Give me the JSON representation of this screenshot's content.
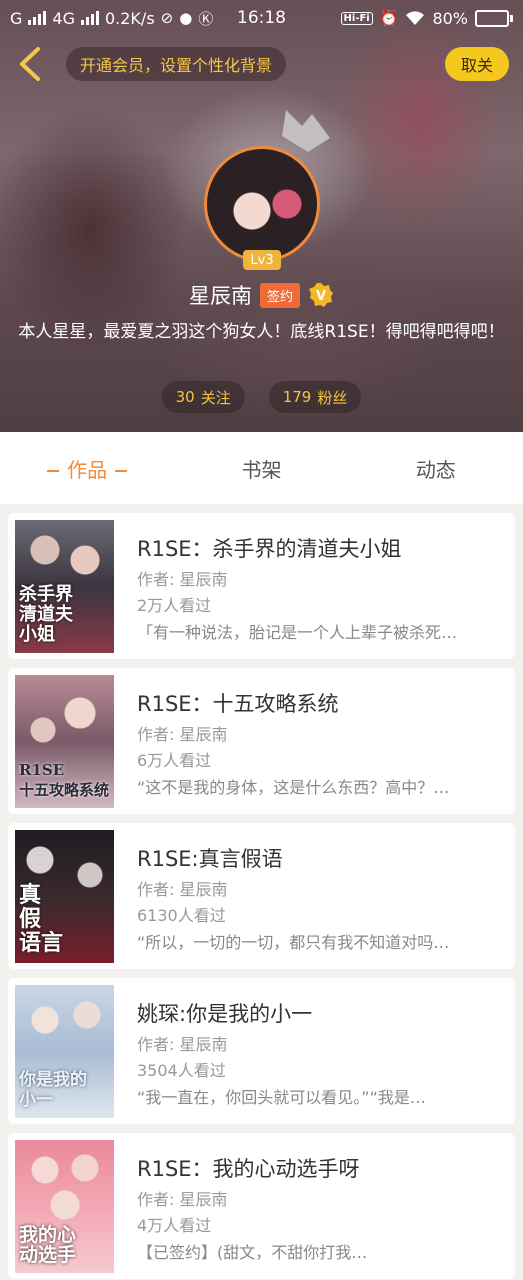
{
  "status_bar": {
    "carrier1": "G",
    "carrier2": "4G",
    "speed": "0.2K/s",
    "time": "16:18",
    "hifi": "Hi-Fi",
    "battery_text": "80%",
    "battery_level": 0.8
  },
  "header": {
    "vip_banner": "开通会员，设置个性化背景",
    "follow_button": "取关",
    "level_badge": "Lv3",
    "user_name": "星辰南",
    "sign_badge": "签约",
    "bio": "本人星星，最爱夏之羽这个狗女人！底线R1SE！得吧得吧得吧！",
    "following_count": "30",
    "following_label": "关注",
    "fans_count": "179",
    "fans_label": "粉丝"
  },
  "tabs": [
    {
      "label": "作品",
      "active": true
    },
    {
      "label": "书架",
      "active": false
    },
    {
      "label": "动态",
      "active": false
    }
  ],
  "books": [
    {
      "title": "R1SE：杀手界的清道夫小姐",
      "author": "作者: 星辰南",
      "views": "2万人看过",
      "excerpt": "「有一种说法，胎记是一个人上辈子被杀死…",
      "cover_text": "杀手界\n清道夫\n小姐"
    },
    {
      "title": "R1SE：十五攻略系统",
      "author": "作者: 星辰南",
      "views": "6万人看过",
      "excerpt": "“这不是我的身体，这是什么东西？高中？…",
      "cover_text": "R1SE\n十五攻略系统"
    },
    {
      "title": "R1SE:真言假语",
      "author": "作者: 星辰南",
      "views": "6130人看过",
      "excerpt": "“所以，一切的一切，都只有我不知道对吗…",
      "cover_text": "真\n假\n语言"
    },
    {
      "title": "姚琛:你是我的小一",
      "author": "作者: 星辰南",
      "views": "3504人看过",
      "excerpt": "“我一直在，你回头就可以看见。”“我是…",
      "cover_text": "你是我的\n小一"
    },
    {
      "title": "R1SE：我的心动选手呀",
      "author": "作者: 星辰南",
      "views": "4万人看过",
      "excerpt": "【已签约】(甜文，不甜你打我…",
      "cover_text": "我的心\n动选手"
    }
  ]
}
